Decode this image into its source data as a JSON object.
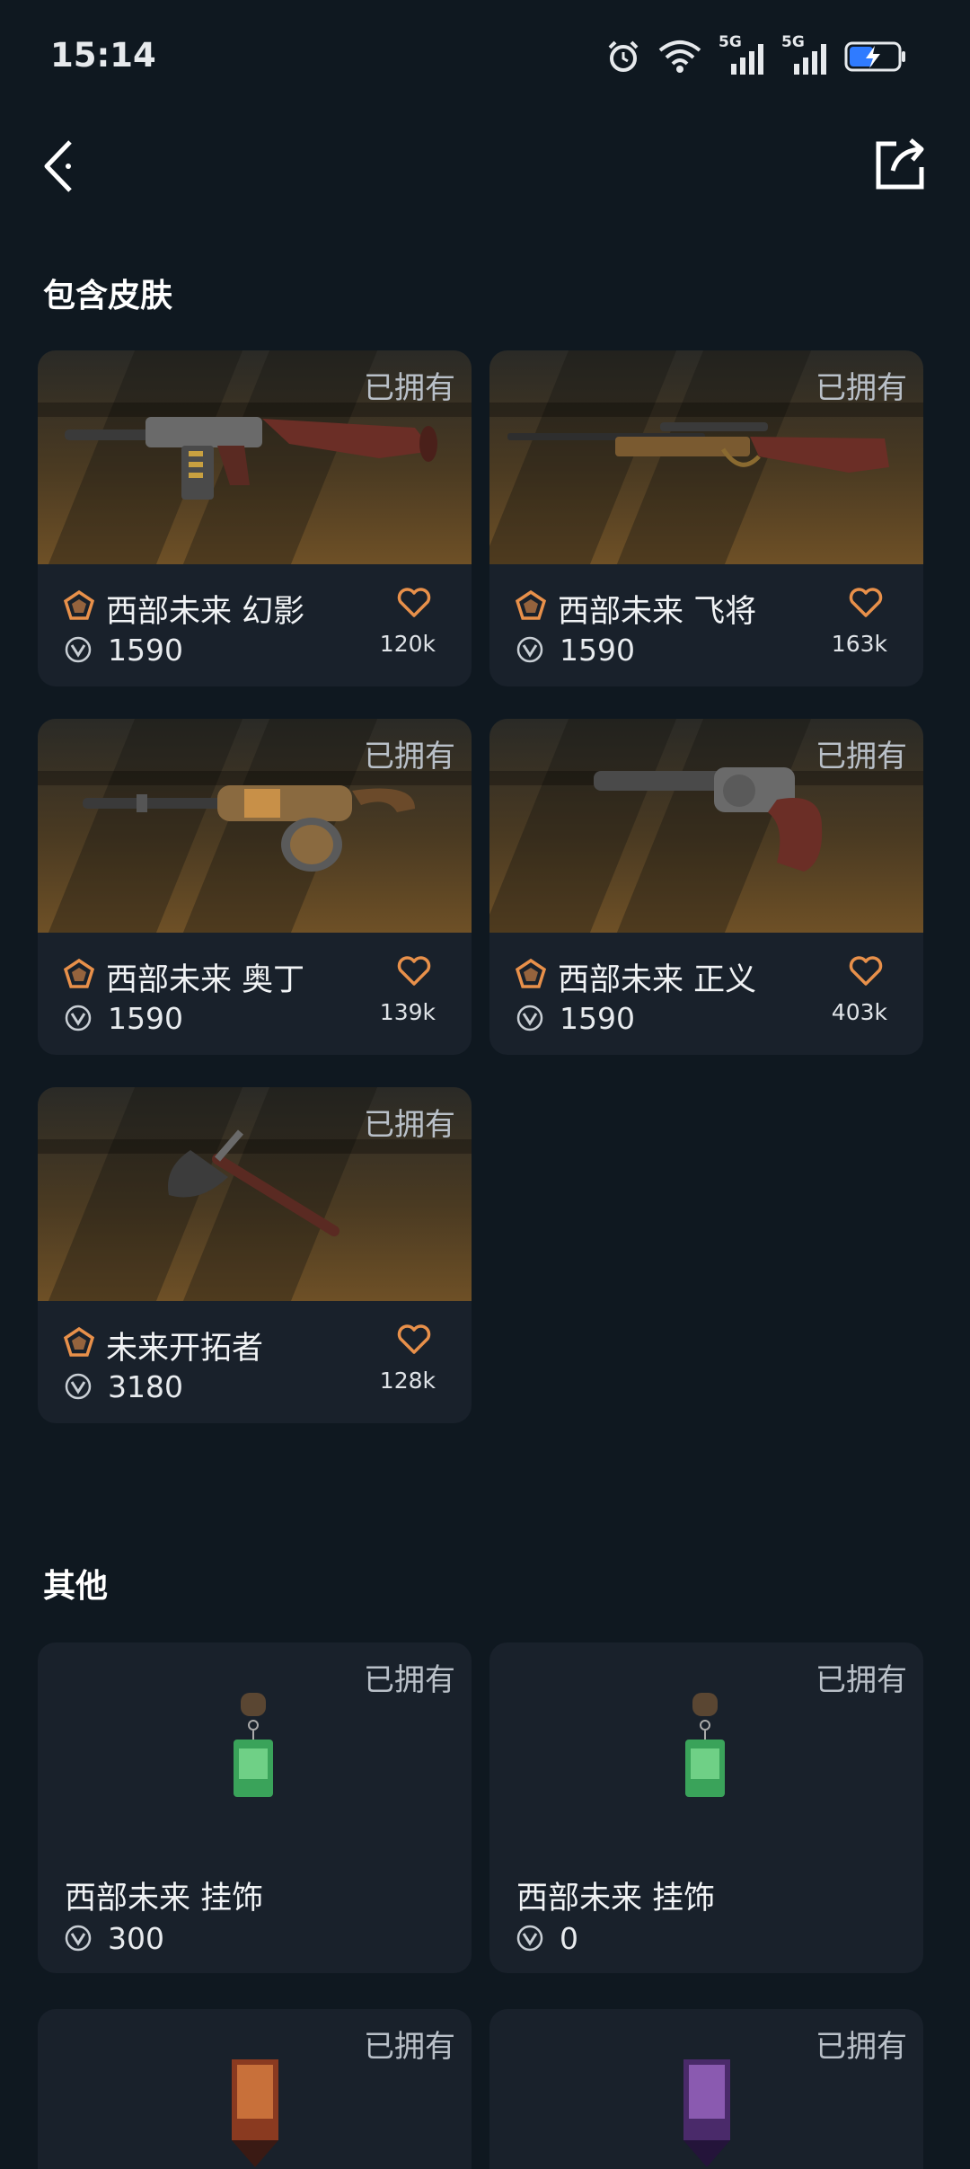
{
  "status_bar": {
    "time": "15:14",
    "signal1": "5G",
    "signal2": "5G"
  },
  "sections": {
    "skins_title": "包含皮肤",
    "other_title": "其他"
  },
  "owned_label": "已拥有",
  "skins": [
    {
      "name": "西部未来 幻影",
      "price": "1590",
      "likes": "120k",
      "icon": "rifle-icon"
    },
    {
      "name": "西部未来 飞将",
      "price": "1590",
      "likes": "163k",
      "icon": "sniper-rifle-icon"
    },
    {
      "name": "西部未来 奥丁",
      "price": "1590",
      "likes": "139k",
      "icon": "machine-gun-icon"
    },
    {
      "name": "西部未来 正义",
      "price": "1590",
      "likes": "403k",
      "icon": "revolver-icon"
    },
    {
      "name": "未来开拓者",
      "price": "3180",
      "likes": "128k",
      "icon": "axe-icon"
    }
  ],
  "others": [
    {
      "name": "西部未来 挂饰",
      "price": "300",
      "icon": "charm-icon"
    },
    {
      "name": "西部未来 挂饰",
      "price": "0",
      "icon": "charm-icon"
    }
  ],
  "colors": {
    "background": "#0f1820",
    "card": "#19212b",
    "accent": "#e8904a"
  }
}
